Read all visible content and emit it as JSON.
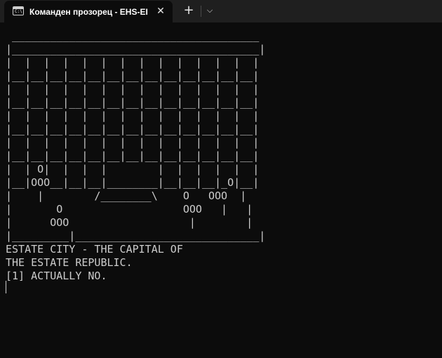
{
  "tab": {
    "icon": "terminal-icon",
    "icon_prompt": "C:\\",
    "title": "Команден прозорец - EHS-EI",
    "close_glyph": "✕",
    "close_icon": "close-icon"
  },
  "tabbar": {
    "new_tab_glyph": "+",
    "new_tab_icon": "plus-icon",
    "dropdown_glyph": "⌵",
    "dropdown_icon": "chevron-down-icon"
  },
  "console": {
    "text": " _______________________________________\n|_______________________________________|\n|  |  |  |  |  |  |  |  |  |  |  |  |  |\n|__|__|__|__|__|__|__|__|__|__|__|__|__|\n|  |  |  |  |  |  |  |  |  |  |  |  |  |\n|__|__|__|__|__|__|__|__|__|__|__|__|__|\n|  |  |  |  |  |  |  |  |  |  |  |  |  |\n|__|__|__|__|__|__|__|__|__|__|__|__|__|\n|  |  |  |  |  |  |  |  |  |  |  |  |  |\n|__|__|__|__|__|__|__|__|__|__|__|__|__|\n|  | O|  |  |  |        |  |  |  |  |  |\n|__|OOO__|__|__|________|__|__|__|_O|__|\n|    |        /________\\    O   OOO  |\n|       O                   OOO   |   |\n|      OOO                   |        |\n|_________|_____________________________|\nESTATE CITY - THE CAPITAL OF\nTHE ESTATE REPUBLIC.\n[1] ACTUALLY NO."
  },
  "colors": {
    "background": "#0c0c0c",
    "tabbar": "#1f1f1f",
    "text": "#cccccc"
  }
}
